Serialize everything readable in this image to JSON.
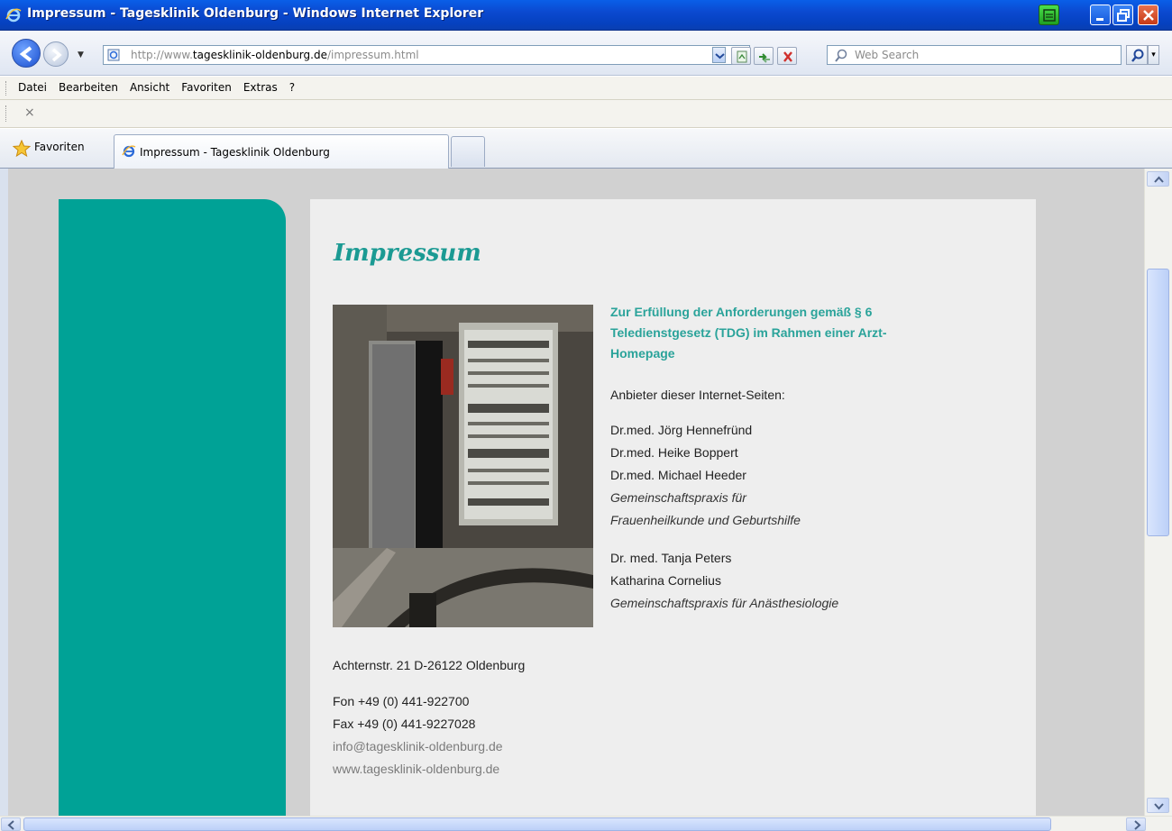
{
  "window": {
    "title": "Impressum - Tagesklinik Oldenburg - Windows Internet Explorer"
  },
  "address_bar": {
    "url_prefix": "http://www.",
    "url_host": "tagesklinik-oldenburg.de",
    "url_path": "/impressum.html",
    "search_placeholder": "Web Search"
  },
  "menu": {
    "items": [
      "Datei",
      "Bearbeiten",
      "Ansicht",
      "Favoriten",
      "Extras",
      "?"
    ]
  },
  "links_bar": {
    "close_label": "×"
  },
  "tabs": {
    "favorites_label": "Favoriten",
    "active_tab_label": "Impressum - Tagesklinik Oldenburg"
  },
  "page": {
    "title": "Impressum",
    "intro": "Zur Erfüllung der Anforderungen gemäß § 6 Teledienstgesetz (TDG) im Rahmen einer Arzt-Homepage",
    "provider_label": "Anbieter dieser Internet-Seiten:",
    "practice1": {
      "doctors": [
        "Dr.med. Jörg Hennefründ",
        "Dr.med. Heike Boppert",
        "Dr.med. Michael Heeder"
      ],
      "description": [
        "Gemeinschaftspraxis für",
        "Frauenheilkunde und Geburtshilfe"
      ]
    },
    "practice2": {
      "doctors": [
        "Dr. med. Tanja Peters",
        "Katharina Cornelius"
      ],
      "description": "Gemeinschaftspraxis für Anästhesiologie"
    },
    "address": "Achternstr. 21 D-26122 Oldenburg",
    "phone": "Fon +49 (0) 441-922700",
    "fax": "Fax +49 (0) 441-9227028",
    "email": "info@tagesklinik-oldenburg.de",
    "website": "www.tagesklinik-oldenburg.de"
  },
  "colors": {
    "teal": "#00a296",
    "heading": "#1b9a93",
    "intro": "#2aa39a",
    "page_bg": "#d1d1d1",
    "content_bg": "#eeeeee"
  }
}
